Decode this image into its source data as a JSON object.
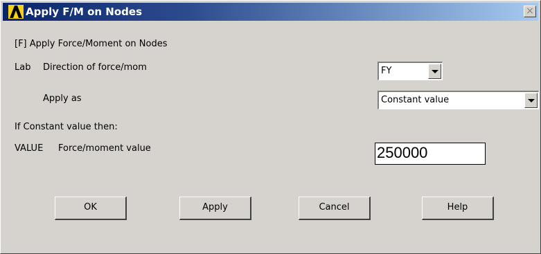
{
  "window": {
    "title": "Apply F/M on Nodes",
    "close_glyph": "×"
  },
  "form": {
    "heading": "[F]  Apply Force/Moment on Nodes",
    "lab": {
      "key": "Lab",
      "label": "Direction of force/mom",
      "value": "FY"
    },
    "apply_as": {
      "label": "Apply as",
      "value": "Constant value"
    },
    "condition_text": "If Constant value then:",
    "value_field": {
      "key": "VALUE",
      "label": "Force/moment value",
      "value": "250000"
    }
  },
  "buttons": {
    "ok": "OK",
    "apply": "Apply",
    "cancel": "Cancel",
    "help": "Help"
  },
  "icons": {
    "app": "ansys-logo-icon",
    "close": "close-icon",
    "dropdown": "chevron-down-icon"
  },
  "colors": {
    "title_gradient_start": "#0a246a",
    "title_gradient_end": "#a6caf0",
    "window_face": "#d6d3ce",
    "logo_yellow": "#f7d117"
  }
}
